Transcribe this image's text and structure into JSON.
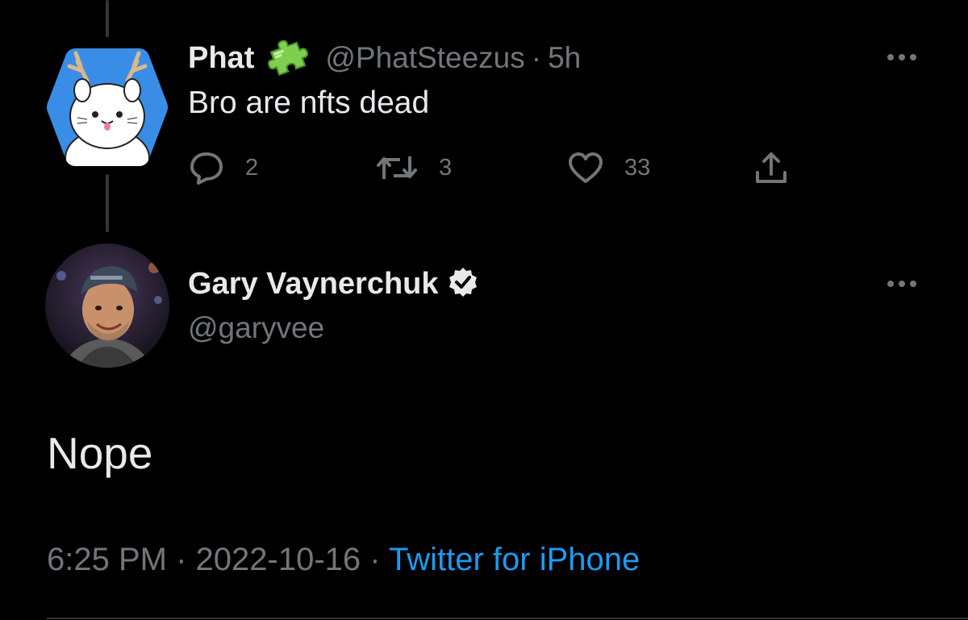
{
  "colors": {
    "background": "#000000",
    "text_primary": "#e7e9ea",
    "text_secondary": "#71767b",
    "link": "#1d9bf0",
    "thread_line": "#333639"
  },
  "parent_tweet": {
    "display_name": "Phat",
    "name_badge_icon": "puzzle-piece-icon",
    "handle": "@PhatSteezus",
    "separator": "·",
    "time_ago": "5h",
    "text": "Bro are nfts dead",
    "actions": {
      "reply_icon": "reply-bubble-icon",
      "reply_count": "2",
      "retweet_icon": "retweet-icon",
      "retweet_count": "3",
      "like_icon": "heart-icon",
      "like_count": "33",
      "share_icon": "share-upload-icon"
    },
    "more_icon": "more-dots-icon"
  },
  "reply_tweet": {
    "display_name": "Gary Vaynerchuk",
    "verified_icon": "verified-badge-icon",
    "handle": "@garyvee",
    "text": "Nope",
    "more_icon": "more-dots-icon",
    "meta": {
      "time": "6:25 PM",
      "separator": "·",
      "date": "2022-10-16",
      "source": "Twitter for iPhone"
    }
  }
}
